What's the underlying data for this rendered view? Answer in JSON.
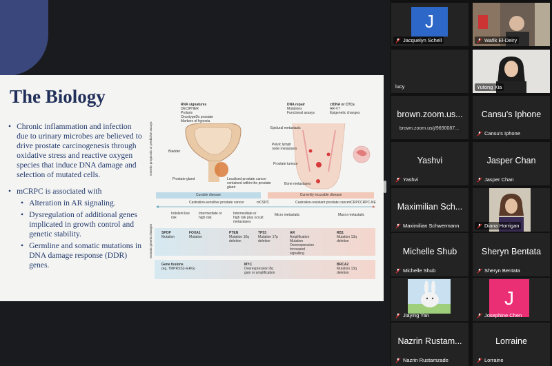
{
  "slide": {
    "title": "The Biology",
    "bullets": [
      {
        "text": "Chronic inflammation and infection due to urinary microbes are believed to drive prostate carcinogenesis through oxidative stress and reactive oxygen species that induce DNA damage and selection of mutated cells."
      },
      {
        "text": "mCRPC is associated with",
        "sub": [
          "Alteration in AR signaling.",
          "Dysregulation of additional genes implicated in growth control and genetic stability.",
          "Germline and somatic mutations in DNA damage response (DDR) genes."
        ]
      }
    ],
    "bullet_glyph": "•",
    "figure": {
      "col1": {
        "title": "RNA signatures",
        "lines": [
          "DECIPHER",
          "Prolaris",
          "OncotypeDx prostate",
          "Markers of hypoxia"
        ]
      },
      "col2": {
        "title": "DNA repair",
        "lines": [
          "Mutations",
          "Functional assays"
        ]
      },
      "col3": {
        "title": "ctDNA or CTCs",
        "lines": [
          "AR-V7",
          "Epigenetic changes"
        ]
      },
      "side_top": "Genetic prognostic or predictive assays",
      "side_bottom": "Somatic genetic changes",
      "labels": {
        "bladder": "Bladder",
        "prostate_gland": "Prostate gland",
        "localised": "Localised prostate cancer contained within the prostate gland",
        "epidural": "Epidural metastasis",
        "pelvic": "Pelvic lymph node metastasis",
        "tumour": "Prostate tumour",
        "bone": "Bone metastases"
      },
      "curable": "Curable disease",
      "incurable": "Currently incurable disease",
      "castration_sensitive": "Castration-sensitive prostate cancer",
      "mcspc": "mCSPC",
      "castration_resistant": "Castration-resistant prostate cancer",
      "mcrpc": "mCRPC",
      "crpcne": "CRPC-NE",
      "stages": [
        "Indolent low risk",
        "Intermediate or high risk",
        "Intermediate or high risk plus occult metastases",
        "Micro metastatic",
        "Macro metastatic"
      ],
      "genes_row1": [
        {
          "name": "SPOP",
          "desc": "Mutation"
        },
        {
          "name": "FOXA1",
          "desc": "Mutation"
        },
        {
          "name": "PTEN",
          "desc": "Mutation 10q deletion"
        },
        {
          "name": "TP53",
          "desc": "Mutation 17p deletion"
        },
        {
          "name": "AR",
          "desc": "Amplification Mutation Overexpression Increased signalling"
        },
        {
          "name": "RB1",
          "desc": "Mutation 13q deletion"
        }
      ],
      "genes_row2": [
        {
          "name": "Gene fusions",
          "desc": "(eg, TMPRSS2–ERG)"
        },
        {
          "name": "MYC",
          "desc": "Overexpression 8q gain or amplification"
        },
        {
          "name": "BRCA2",
          "desc": "Mutation 13q deletion"
        }
      ]
    }
  },
  "participants": [
    {
      "name": "Jacquelyn Schell",
      "kind": "avatar",
      "avatar_letter": "J",
      "avatar_color": "#2d67c8",
      "muted": true
    },
    {
      "name": "Wafik El-Deiry",
      "kind": "video",
      "muted": true
    },
    {
      "name": "lucy",
      "kind": "blank",
      "muted": false
    },
    {
      "name": "Yutong Xia",
      "kind": "video",
      "muted": false,
      "active": true
    },
    {
      "name": "Cansu's Iphone",
      "kind": "name",
      "display": "Cansu's Iphone",
      "muted": true
    },
    {
      "name": "brown.zoom.us/j/9690087...",
      "kind": "name",
      "display": "brown.zoom.us...",
      "muted": false
    },
    {
      "name": "Yashvi",
      "kind": "name",
      "display": "Yashvi",
      "muted": true
    },
    {
      "name": "Jasper Chan",
      "kind": "name",
      "display": "Jasper Chan",
      "muted": true
    },
    {
      "name": "Maximilian Schwermann",
      "kind": "name",
      "display": "Maximilian Sch...",
      "muted": true
    },
    {
      "name": "Diana Horrigan",
      "kind": "video",
      "muted": true
    },
    {
      "name": "Michelle Shub",
      "kind": "name",
      "display": "Michelle Shub",
      "muted": true
    },
    {
      "name": "Sheryn Bentata",
      "kind": "name",
      "display": "Sheryn Bentata",
      "muted": true
    },
    {
      "name": "Jiaying Yan",
      "kind": "image",
      "muted": true
    },
    {
      "name": "Josephine Chen",
      "kind": "avatar",
      "avatar_letter": "J",
      "avatar_color": "#ea2f75",
      "muted": true
    },
    {
      "name": "Nazrin Rustamzade",
      "kind": "name",
      "display": "Nazrin Rustam...",
      "muted": true
    },
    {
      "name": "Lorraine",
      "kind": "name",
      "display": "Lorraine",
      "muted": true
    }
  ],
  "colors": {
    "active_speaker": "#66d12e",
    "mute": "#e02a2a",
    "slide_title": "#21305a",
    "slide_text": "#233b6e"
  }
}
